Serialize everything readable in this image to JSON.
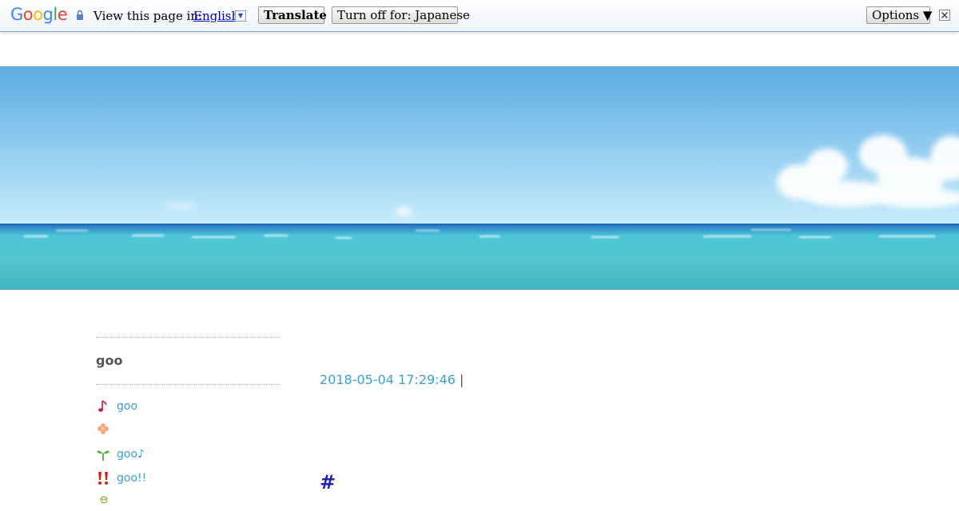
{
  "translate_bar": {
    "logo": {
      "letters": [
        "G",
        "o",
        "o",
        "g",
        "l",
        "e"
      ],
      "colors": [
        "#4285F4",
        "#EA4335",
        "#FBBC05",
        "#4285F4",
        "#34A853",
        "#EA4335"
      ]
    },
    "view_label": "View this page in:",
    "language": "English",
    "translate_button": "Translate",
    "turn_off_button": "Turn off for: Japanese",
    "options_button": "Options ▼"
  },
  "sidebar": {
    "title": "goo",
    "items": [
      {
        "icon": "music-note-icon",
        "label": "goo"
      },
      {
        "icon": "flower-icon",
        "label": ""
      },
      {
        "icon": "sprout-icon",
        "label": "goo♪"
      },
      {
        "icon": "double-exclamation-icon",
        "label": "goo!!"
      },
      {
        "icon": "small-face-icon",
        "label": ""
      }
    ]
  },
  "post": {
    "date": "2018-05-04 17:29:46",
    "separator": "|",
    "hashtag": "#"
  },
  "colors": {
    "link": "#3a9fd8",
    "hashtag": "#2222bb",
    "bar_border": "#7f9ed6"
  }
}
